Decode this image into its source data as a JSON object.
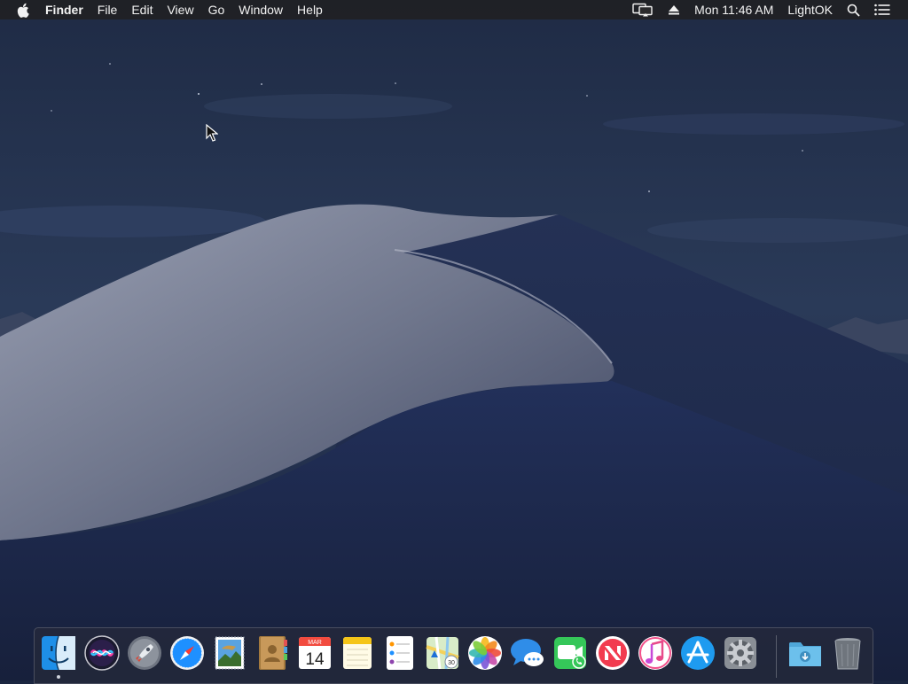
{
  "menubar": {
    "apple_icon": "apple-logo-icon",
    "app_name": "Finder",
    "menus": [
      "File",
      "Edit",
      "View",
      "Go",
      "Window",
      "Help"
    ],
    "status": {
      "display_icon": "airplay-display-icon",
      "eject_icon": "eject-icon",
      "clock": "Mon 11:46 AM",
      "user": "LightOK",
      "spotlight_icon": "spotlight-search-icon",
      "notification_icon": "notification-center-icon"
    }
  },
  "desktop": {
    "wallpaper": "mojave-night-dunes",
    "sky_color": "#2a3a58",
    "dune_color": "#7d8398"
  },
  "dock": {
    "apps": [
      {
        "name": "Finder",
        "icon": "finder-icon",
        "running": true
      },
      {
        "name": "Siri",
        "icon": "siri-icon"
      },
      {
        "name": "Launchpad",
        "icon": "launchpad-rocket-icon"
      },
      {
        "name": "Safari",
        "icon": "safari-compass-icon"
      },
      {
        "name": "Mail",
        "icon": "mail-stamp-icon"
      },
      {
        "name": "Contacts",
        "icon": "contacts-book-icon"
      },
      {
        "name": "Calendar",
        "icon": "calendar-icon",
        "month": "MAR",
        "day": "14"
      },
      {
        "name": "Notes",
        "icon": "notes-icon"
      },
      {
        "name": "Reminders",
        "icon": "reminders-icon"
      },
      {
        "name": "Maps",
        "icon": "maps-icon",
        "badge": "30"
      },
      {
        "name": "Photos",
        "icon": "photos-flower-icon"
      },
      {
        "name": "Messages",
        "icon": "messages-bubble-icon"
      },
      {
        "name": "FaceTime",
        "icon": "facetime-camera-icon"
      },
      {
        "name": "News",
        "icon": "news-icon"
      },
      {
        "name": "iTunes",
        "icon": "itunes-note-icon"
      },
      {
        "name": "App Store",
        "icon": "app-store-icon"
      },
      {
        "name": "System Preferences",
        "icon": "gear-icon"
      }
    ],
    "others": [
      {
        "name": "Downloads",
        "icon": "downloads-folder-icon"
      },
      {
        "name": "Trash",
        "icon": "trash-icon"
      }
    ]
  }
}
